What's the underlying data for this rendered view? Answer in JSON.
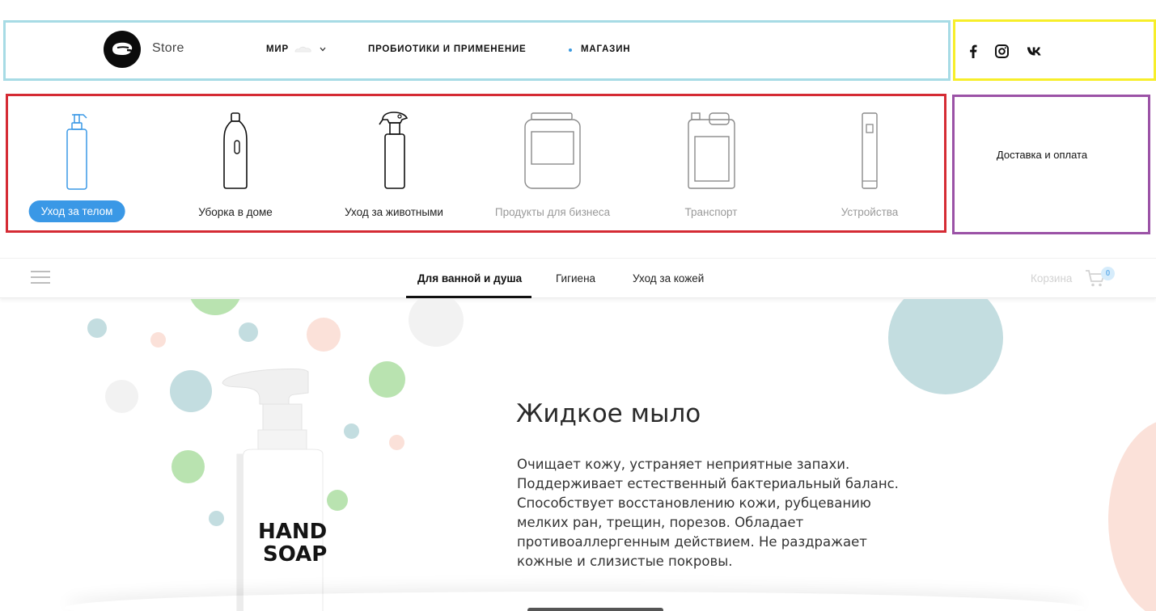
{
  "header": {
    "store_label": "Store",
    "nav": {
      "mir_label": "МИР",
      "probiotics_label": "ПРОБИОТИКИ И ПРИМЕНЕНИЕ",
      "shop_label": "МАГАЗИН"
    },
    "social": [
      "facebook-icon",
      "instagram-icon",
      "vk-icon"
    ]
  },
  "categories": [
    {
      "label": "Уход за телом",
      "active": true,
      "icon": "pump-bottle-icon"
    },
    {
      "label": "Уборка в доме",
      "active": false,
      "icon": "detergent-bottle-icon"
    },
    {
      "label": "Уход за животными",
      "active": false,
      "icon": "spray-bottle-icon"
    },
    {
      "label": "Продукты для бизнеса",
      "active": false,
      "icon": "canister-icon"
    },
    {
      "label": "Транспорт",
      "active": false,
      "icon": "jerrycan-icon"
    },
    {
      "label": "Устройства",
      "active": false,
      "icon": "device-icon"
    }
  ],
  "delivery_label": "Доставка и оплата",
  "subnav": {
    "tabs": [
      "Для ванной и душа",
      "Гигиена",
      "Уход за кожей"
    ],
    "active_tab": "Для ванной и душа",
    "cart_label": "Корзина",
    "cart_count": "0"
  },
  "hero": {
    "title": "Жидкое мыло",
    "description": "Очищает кожу, устраняет неприятные запахи. Поддерживает естественный бактериальный баланс. Способствует восстановлению кожи, рубцеванию мелких ран, трещин, порезов. Обладает противоаллергенным действием. Не раздражает кожные и слизистые покровы.",
    "bottle_text_line1": "HAND",
    "bottle_text_line2": "SOAP"
  },
  "colors": {
    "accent": "#3a98e6",
    "dot_green": "#b9e3b0",
    "dot_blue": "#c3dde0",
    "dot_pink": "#fbe1d9",
    "dot_grey": "#f2f2f2"
  }
}
